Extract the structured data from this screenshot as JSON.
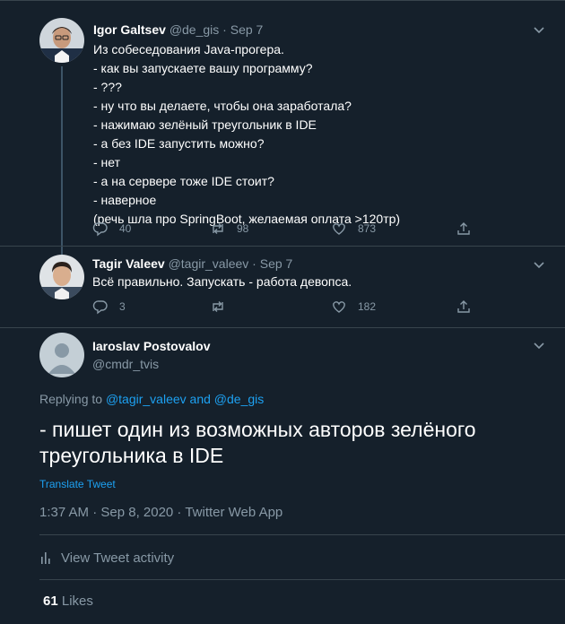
{
  "tweets": [
    {
      "name": "Igor Galtsev",
      "handle": "@de_gis",
      "dot": "·",
      "date": "Sep 7",
      "lines": [
        "Из собеседования Java-прогера.",
        "- как вы запускаете вашу программу?",
        "- ???",
        "- ну что вы делаете, чтобы она заработала?",
        "- нажимаю зелёный треугольник в IDE",
        "- а без IDE запустить можно?",
        "- нет",
        "- а на сервере тоже IDE стоит?",
        "- наверное",
        "(речь шла про SpringBoot, желаемая оплата >120тр)"
      ],
      "replies": "40",
      "retweets": "98",
      "likes": "873"
    },
    {
      "name": "Tagir Valeev",
      "handle": "@tagir_valeev",
      "dot": "·",
      "date": "Sep 7",
      "lines": [
        "Всё правильно. Запускать - работа девопса."
      ],
      "replies": "3",
      "retweets": "",
      "likes": "182"
    }
  ],
  "main": {
    "name": "Iaroslav Postovalov",
    "handle": "@cmdr_tvis",
    "replying_prefix": "Replying to",
    "replying_user1": "@tagir_valeev",
    "replying_and": "and",
    "replying_user2": "@de_gis",
    "text": "- пишет один из возможных авторов зелёного треугольника в IDE",
    "translate": "Translate Tweet",
    "meta": "1:37 AM · Sep 8, 2020 · Twitter Web App",
    "activity": "View Tweet activity",
    "likes_count": "61",
    "likes_label": "Likes"
  },
  "colors": {
    "background": "#15202b",
    "accent": "#1da1f2",
    "muted": "#8899a6",
    "border": "#38444d"
  }
}
